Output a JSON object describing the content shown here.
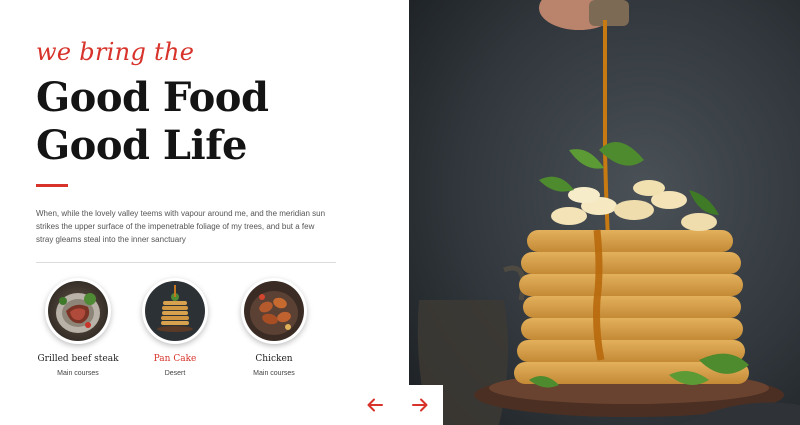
{
  "hero": {
    "tagline": "we bring the",
    "title_line1": "Good Food",
    "title_line2": "Good Life",
    "description": "When, while the lovely valley teems with vapour around me, and the meridian sun strikes the upper surface of the impenetrable foliage of my trees, and but a few stray gleams steal into the inner sanctuary"
  },
  "items": [
    {
      "name": "Grilled beef steak",
      "category": "Main courses",
      "active": false
    },
    {
      "name": "Pan Cake",
      "category": "Desert",
      "active": true
    },
    {
      "name": "Chicken",
      "category": "Main courses",
      "active": false
    }
  ],
  "colors": {
    "accent": "#d7332b",
    "text": "#141414"
  },
  "icons": {
    "prev": "arrow-left-icon",
    "next": "arrow-right-icon"
  }
}
